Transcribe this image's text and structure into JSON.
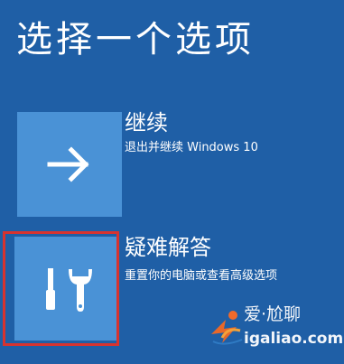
{
  "screen": {
    "title": "选择一个选项"
  },
  "options": [
    {
      "heading": "继续",
      "description": "退出并继续 Windows 10",
      "icon": "arrow-right-icon"
    },
    {
      "heading": "疑难解答",
      "description": "重置你的电脑或查看高级选项",
      "icon": "tools-icon"
    }
  ],
  "highlight": {
    "target": "troubleshoot",
    "color": "#d7332f"
  },
  "watermark": {
    "title": "爱·尬聊",
    "url": "igaliao.com",
    "icon": "runner-logo-icon"
  },
  "colors": {
    "background": "#1f5fa6",
    "tile": "#4a92d6",
    "text": "#ffffff"
  }
}
